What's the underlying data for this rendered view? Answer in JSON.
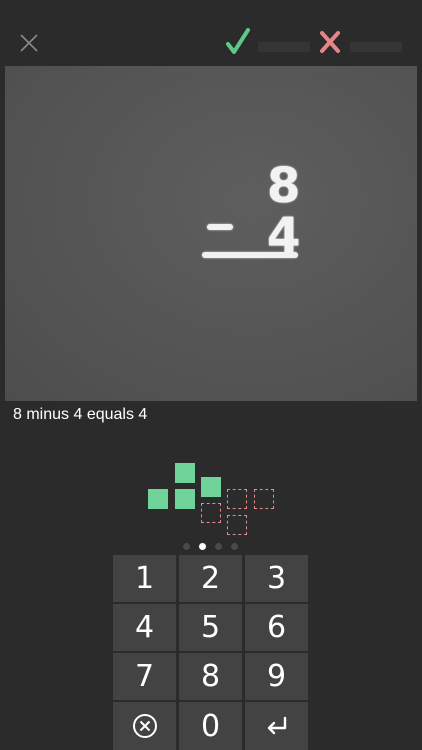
{
  "topbar": {
    "close_icon": "close-icon",
    "correct_icon": "checkmark-icon",
    "wrong_icon": "x-icon",
    "correct_color": "#5cc98a",
    "wrong_color": "#e3868a"
  },
  "problem": {
    "top_number": "8",
    "operator": "minus",
    "bottom_number": "4"
  },
  "caption": "8 minus 4 equals 4",
  "blocks": {
    "filled_count": 4,
    "empty_count": 4,
    "filled_color": "#6fd39a",
    "empty_color": "#e58a8a"
  },
  "pager": {
    "total": 4,
    "active_index": 1
  },
  "keypad": {
    "keys": [
      "1",
      "2",
      "3",
      "4",
      "5",
      "6",
      "7",
      "8",
      "9"
    ],
    "clear_icon": "clear-icon",
    "zero": "0",
    "enter_icon": "enter-icon"
  }
}
